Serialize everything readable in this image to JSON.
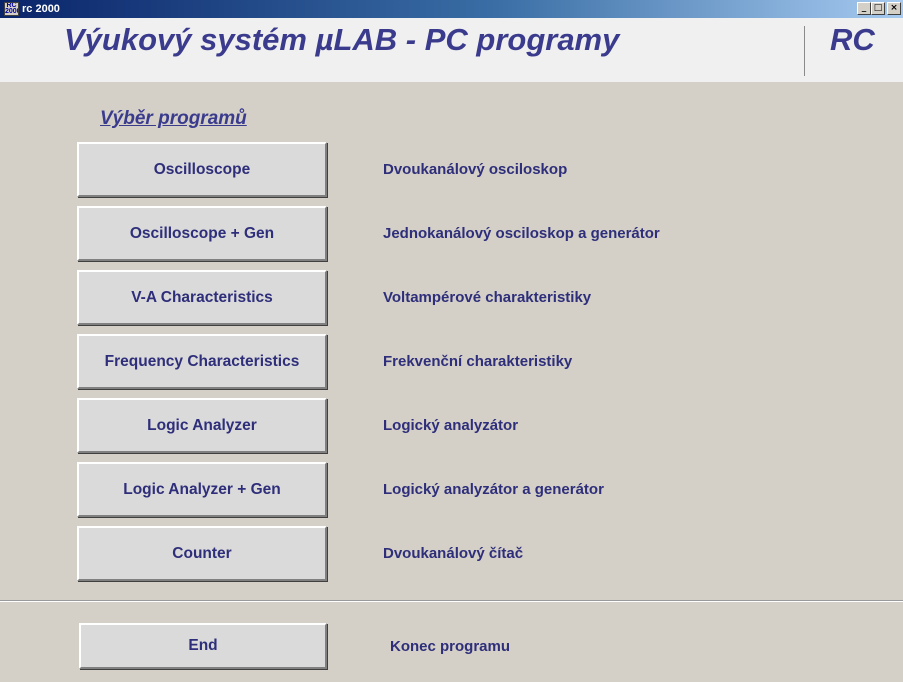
{
  "window": {
    "icon_text": "RC 2000",
    "title": "rc 2000",
    "min_glyph": "_",
    "max_glyph": "□",
    "close_glyph": "×"
  },
  "header": {
    "title": "Výukový systém µLAB - PC programy",
    "logo": "RC"
  },
  "section_heading": "Výběr programů",
  "programs": [
    {
      "label": "Oscilloscope",
      "description": "Dvoukanálový osciloskop"
    },
    {
      "label": "Oscilloscope + Gen",
      "description": "Jednokanálový osciloskop a generátor"
    },
    {
      "label": "V-A Characteristics",
      "description": "Voltampérové charakteristiky"
    },
    {
      "label": "Frequency Characteristics",
      "description": "Frekvenční charakteristiky"
    },
    {
      "label": "Logic Analyzer",
      "description": "Logický analyzátor"
    },
    {
      "label": "Logic Analyzer + Gen",
      "description": "Logický analyzátor a generátor"
    },
    {
      "label": "Counter",
      "description": "Dvoukanálový čítač"
    }
  ],
  "end": {
    "label": "End",
    "description": "Konec programu"
  },
  "colors": {
    "accent_text": "#2e2e7a",
    "background": "#d4d0c8"
  }
}
